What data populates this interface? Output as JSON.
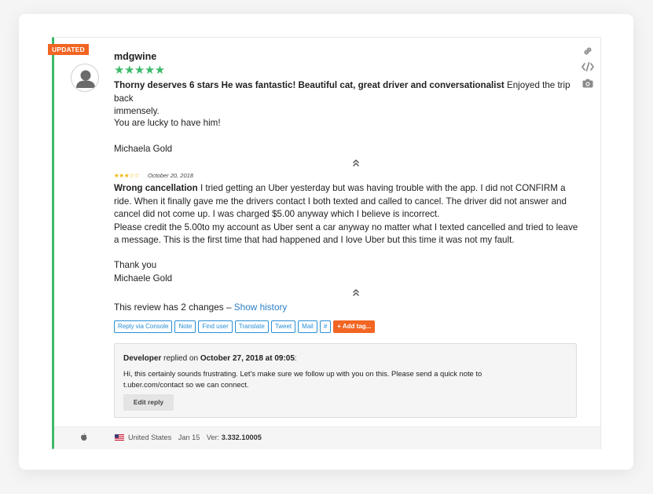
{
  "badge": "UPDATED",
  "review": {
    "author": "mdgwine",
    "rating_stars": "★★★★★",
    "title": "Thorny deserves 6 stars He was fantastic! Beautiful cat, great driver and conversationalist",
    "body_line1_rest": " Enjoyed the trip back",
    "body_line2": "immensely.",
    "para2": "You are lucky to have him!",
    "para3": "Michaela Gold"
  },
  "previous_review": {
    "rating_stars": "★★★☆☆",
    "date": "October 20, 2018",
    "title": "Wrong cancellation",
    "line1_rest": " I tried getting an Uber yesterday but was having trouble with the app. I did not CONFIRM a",
    "line2": "ride. When it finally gave me the drivers contact I both texted and called to cancel. The driver did not answer and",
    "line3": "cancel did not come up. I was charged $5.00 anyway which I believe is incorrect.",
    "line4": "Please credit the 5.00to my account as Uber sent a car anyway no matter what I texted cancelled and tried to leave",
    "line5": "a message. This is the first time that had happened and I love Uber but this time it was not my fault.",
    "line6": "Thank you",
    "line7": "Michaele Gold"
  },
  "history": {
    "prefix": "This review has 2 changes – ",
    "link": "Show history"
  },
  "actions": {
    "reply_console": "Reply via Console",
    "note": "Note",
    "find_user": "Find user",
    "translate": "Translate",
    "tweet": "Tweet",
    "mail": "Mail",
    "hash": "#",
    "add_tag": "+ Add tag..."
  },
  "reply": {
    "developer": "Developer",
    "replied_on": " replied on ",
    "date": "October 27, 2018 at 09:05",
    "colon": ":",
    "line1": "Hi, this certainly sounds frustrating. Let's make sure we follow up with you on this. Please send a quick note to",
    "line2": "t.uber.com/contact so we can connect.",
    "edit_button": "Edit reply"
  },
  "footer": {
    "country": "United States",
    "date": "Jan 15",
    "version_label": "Ver: ",
    "version": "3.332.10005"
  },
  "icons": {
    "link": "link-icon",
    "code": "code-icon",
    "camera": "camera-icon",
    "collapse": "double-chevron-up-icon",
    "platform": "apple-icon",
    "flag": "us-flag-icon"
  },
  "colors": {
    "accent_green": "#3cba6b",
    "badge_orange": "#f26522",
    "link_blue": "#2a7ec6",
    "star_yellow": "#f0b400"
  }
}
